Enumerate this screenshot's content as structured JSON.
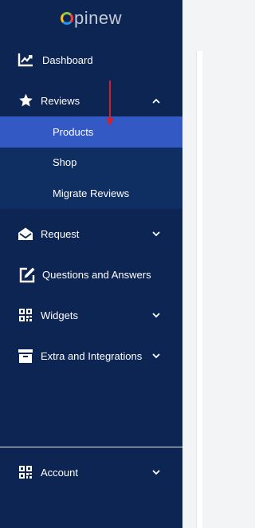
{
  "brand": {
    "logo_text": "pinew"
  },
  "nav": {
    "dashboard": {
      "label": "Dashboard",
      "icon": "chart-line-icon"
    },
    "reviews": {
      "label": "Reviews",
      "icon": "star-icon",
      "expanded": true,
      "children": [
        {
          "label": "Products",
          "active": true
        },
        {
          "label": "Shop",
          "active": false
        },
        {
          "label": "Migrate Reviews",
          "active": false
        }
      ]
    },
    "request": {
      "label": "Request",
      "icon": "envelope-open-icon"
    },
    "questions": {
      "label": "Questions and Answers",
      "icon": "edit-square-icon"
    },
    "widgets": {
      "label": "Widgets",
      "icon": "qr-code-icon"
    },
    "extra": {
      "label": "Extra and Integrations",
      "icon": "archive-box-icon"
    }
  },
  "footer": {
    "account": {
      "label": "Account",
      "icon": "qr-code-icon"
    }
  },
  "colors": {
    "sidebar_bg": "#0d2553",
    "submenu_bg": "#0f2f63",
    "active_bg": "#3359c5",
    "annotation_arrow": "#d61f2a"
  }
}
